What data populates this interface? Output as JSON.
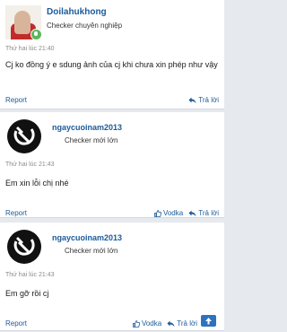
{
  "posts": [
    {
      "username": "Doilahukhong",
      "user_title": "Checker chuyên nghiệp",
      "time": "Thứ hai lúc 21:40",
      "message": "Cj ko đồng ý e sdung ảnh của cj khi chưa xin phép như vậy",
      "report_label": "Report",
      "like_label": "",
      "reply_label": "Trả lời",
      "avatar": "user-photo"
    },
    {
      "username": "ngaycuoinam2013",
      "user_title": "Checker mới lớn",
      "time": "Thứ hai lúc 21:43",
      "message": "Em xin lỗi chị nhé",
      "report_label": "Report",
      "like_label": "Vodka",
      "reply_label": "Trả lời",
      "avatar": "hammer-sickle-logo"
    },
    {
      "username": "ngaycuoinam2013",
      "user_title": "Checker mới lớn",
      "time": "Thứ hai lúc 21:43",
      "message": "Em gỡ rồi cj",
      "report_label": "Report",
      "like_label": "Vodka",
      "reply_label": "Trả lời",
      "avatar": "hammer-sickle-logo"
    }
  ],
  "colors": {
    "link": "#1c5a9a",
    "background": "#e6e9ee",
    "scroll_top_button": "#2d72c0",
    "online": "#5bb85b"
  },
  "icons": [
    "online-status-icon",
    "reply-icon",
    "like-icon",
    "scroll-top-icon",
    "hammer-sickle-logo"
  ]
}
